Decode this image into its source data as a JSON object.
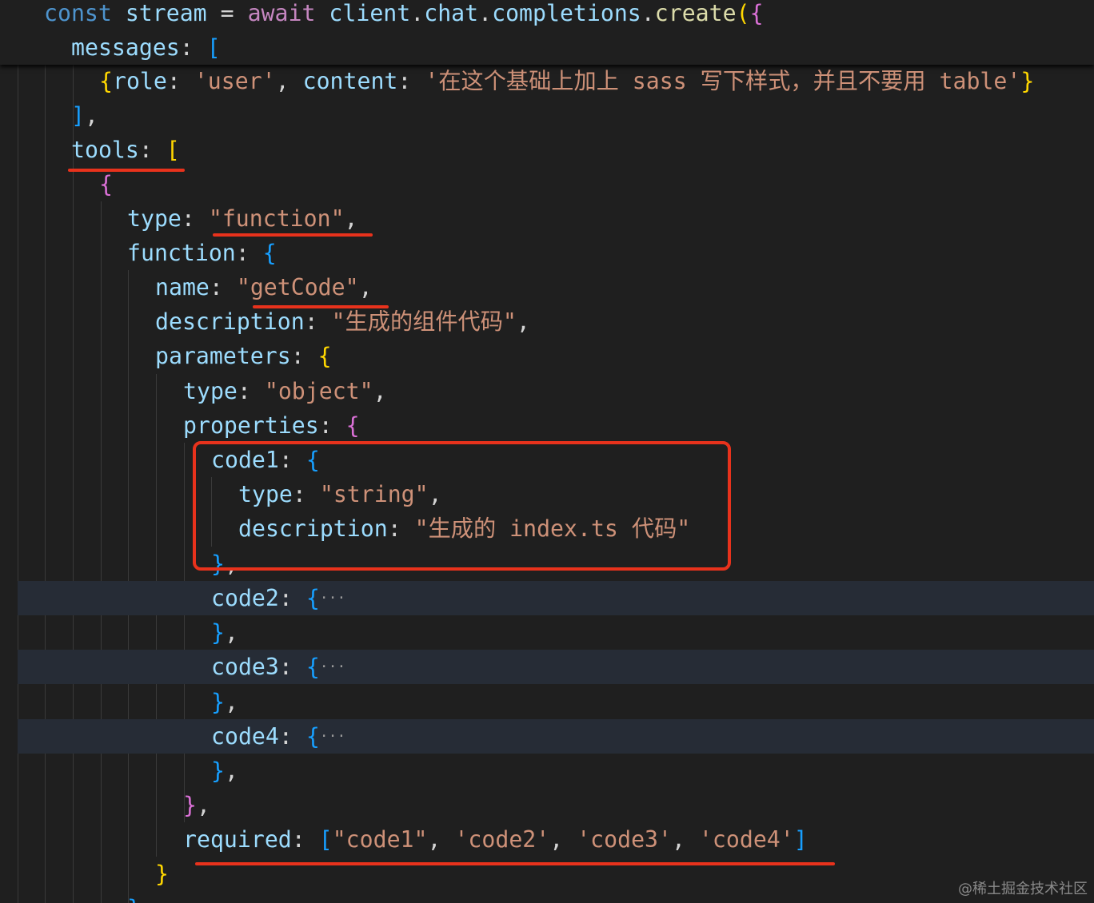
{
  "editor": {
    "theme_colors": {
      "background": "#1f1f1f",
      "keyword": "#4e94ce",
      "property": "#9cdcfe",
      "function": "#dcdcaa",
      "await": "#c586c0",
      "string": "#ce9178",
      "bracket_gold": "#ffd700",
      "bracket_pink": "#da70d6",
      "bracket_blue": "#179fff",
      "annotation_red": "#e8321c"
    },
    "lines": [
      [
        [
          "kw",
          "const "
        ],
        [
          "var",
          "stream "
        ],
        [
          "op",
          "= "
        ],
        [
          "aw",
          "await "
        ],
        [
          "var",
          "client"
        ],
        [
          "op",
          "."
        ],
        [
          "var",
          "chat"
        ],
        [
          "op",
          "."
        ],
        [
          "var",
          "completions"
        ],
        [
          "op",
          "."
        ],
        [
          "fn",
          "create"
        ],
        [
          "b1",
          "("
        ],
        [
          "b2",
          "{"
        ]
      ],
      [
        [
          "var",
          "messages"
        ],
        [
          "op",
          ": "
        ],
        [
          "b3",
          "["
        ]
      ],
      [
        [
          "b1",
          "{"
        ],
        [
          "var",
          "role"
        ],
        [
          "op",
          ": "
        ],
        [
          "str",
          "'user'"
        ],
        [
          "op",
          ", "
        ],
        [
          "var",
          "content"
        ],
        [
          "op",
          ": "
        ],
        [
          "str",
          "'在这个基础上加上 sass 写下样式，并且不要用 table'"
        ],
        [
          "b1",
          "}"
        ]
      ],
      [
        [
          "b3",
          "]"
        ],
        [
          "op",
          ","
        ]
      ],
      [
        [
          "var",
          "tools"
        ],
        [
          "op",
          ": "
        ],
        [
          "b1",
          "["
        ]
      ],
      [
        [
          "b2",
          "{"
        ]
      ],
      [
        [
          "var",
          "type"
        ],
        [
          "op",
          ": "
        ],
        [
          "str",
          "\"function\""
        ],
        [
          "op",
          ","
        ]
      ],
      [
        [
          "var",
          "function"
        ],
        [
          "op",
          ": "
        ],
        [
          "b3",
          "{"
        ]
      ],
      [
        [
          "var",
          "name"
        ],
        [
          "op",
          ": "
        ],
        [
          "str",
          "\"getCode\""
        ],
        [
          "op",
          ","
        ]
      ],
      [
        [
          "var",
          "description"
        ],
        [
          "op",
          ": "
        ],
        [
          "str",
          "\"生成的组件代码\""
        ],
        [
          "op",
          ","
        ]
      ],
      [
        [
          "var",
          "parameters"
        ],
        [
          "op",
          ": "
        ],
        [
          "b1",
          "{"
        ]
      ],
      [
        [
          "var",
          "type"
        ],
        [
          "op",
          ": "
        ],
        [
          "str",
          "\"object\""
        ],
        [
          "op",
          ","
        ]
      ],
      [
        [
          "var",
          "properties"
        ],
        [
          "op",
          ": "
        ],
        [
          "b2",
          "{"
        ]
      ],
      [
        [
          "var",
          "code1"
        ],
        [
          "op",
          ": "
        ],
        [
          "b3",
          "{"
        ]
      ],
      [
        [
          "var",
          "type"
        ],
        [
          "op",
          ": "
        ],
        [
          "str",
          "\"string\""
        ],
        [
          "op",
          ","
        ]
      ],
      [
        [
          "var",
          "description"
        ],
        [
          "op",
          ": "
        ],
        [
          "str",
          "\"生成的 index.ts 代码\""
        ]
      ],
      [
        [
          "b3",
          "}"
        ],
        [
          "op",
          ","
        ]
      ],
      [
        [
          "var",
          "code2"
        ],
        [
          "op",
          ": "
        ],
        [
          "b3",
          "{"
        ],
        [
          "ell",
          "···"
        ]
      ],
      [
        [
          "b3",
          "}"
        ],
        [
          "op",
          ","
        ]
      ],
      [
        [
          "var",
          "code3"
        ],
        [
          "op",
          ": "
        ],
        [
          "b3",
          "{"
        ],
        [
          "ell",
          "···"
        ]
      ],
      [
        [
          "b3",
          "}"
        ],
        [
          "op",
          ","
        ]
      ],
      [
        [
          "var",
          "code4"
        ],
        [
          "op",
          ": "
        ],
        [
          "b3",
          "{"
        ],
        [
          "ell",
          "···"
        ]
      ],
      [
        [
          "b3",
          "}"
        ],
        [
          "op",
          ","
        ]
      ],
      [
        [
          "b2",
          "}"
        ],
        [
          "op",
          ","
        ]
      ],
      [
        [
          "var",
          "required"
        ],
        [
          "op",
          ": "
        ],
        [
          "b3",
          "["
        ],
        [
          "str",
          "\"code1\""
        ],
        [
          "op",
          ", "
        ],
        [
          "str",
          "'code2'"
        ],
        [
          "op",
          ", "
        ],
        [
          "str",
          "'code3'"
        ],
        [
          "op",
          ", "
        ],
        [
          "str",
          "'code4'"
        ],
        [
          "b3",
          "]"
        ]
      ],
      [
        [
          "b1",
          "}"
        ]
      ],
      [
        [
          "b3",
          "}"
        ]
      ]
    ]
  },
  "watermark": "@稀土掘金技术社区"
}
